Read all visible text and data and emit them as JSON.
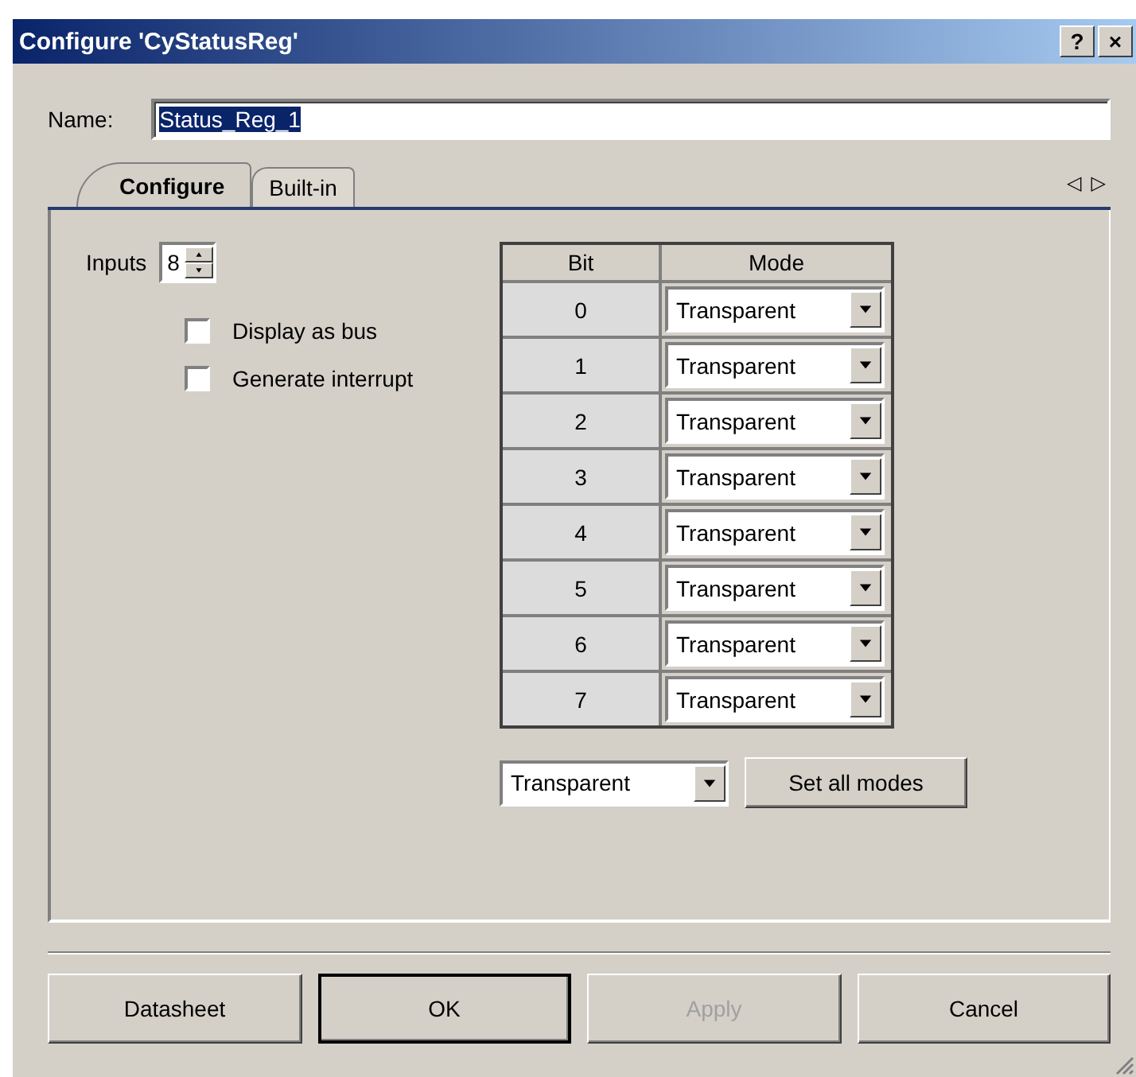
{
  "window": {
    "title": "Configure 'CyStatusReg'",
    "help": "?",
    "close": "×"
  },
  "name": {
    "label": "Name:",
    "value": "Status_Reg_1"
  },
  "tabs": [
    {
      "label": "Configure",
      "selected": true
    },
    {
      "label": "Built-in",
      "selected": false
    }
  ],
  "tab_scroll": {
    "left": "◁",
    "right": "▷"
  },
  "inputs": {
    "label": "Inputs",
    "value": "8"
  },
  "checkboxes": [
    {
      "label": "Display as bus",
      "checked": false
    },
    {
      "label": "Generate interrupt",
      "checked": false
    }
  ],
  "table": {
    "columns": [
      "Bit",
      "Mode"
    ],
    "rows": [
      {
        "bit": "0",
        "mode": "Transparent"
      },
      {
        "bit": "1",
        "mode": "Transparent"
      },
      {
        "bit": "2",
        "mode": "Transparent"
      },
      {
        "bit": "3",
        "mode": "Transparent"
      },
      {
        "bit": "4",
        "mode": "Transparent"
      },
      {
        "bit": "5",
        "mode": "Transparent"
      },
      {
        "bit": "6",
        "mode": "Transparent"
      },
      {
        "bit": "7",
        "mode": "Transparent"
      }
    ]
  },
  "all_modes": {
    "value": "Transparent",
    "button": "Set all modes"
  },
  "buttons": [
    {
      "label": "Datasheet",
      "default": false,
      "disabled": false
    },
    {
      "label": "OK",
      "default": true,
      "disabled": false
    },
    {
      "label": "Apply",
      "default": false,
      "disabled": true
    },
    {
      "label": "Cancel",
      "default": false,
      "disabled": false
    }
  ]
}
